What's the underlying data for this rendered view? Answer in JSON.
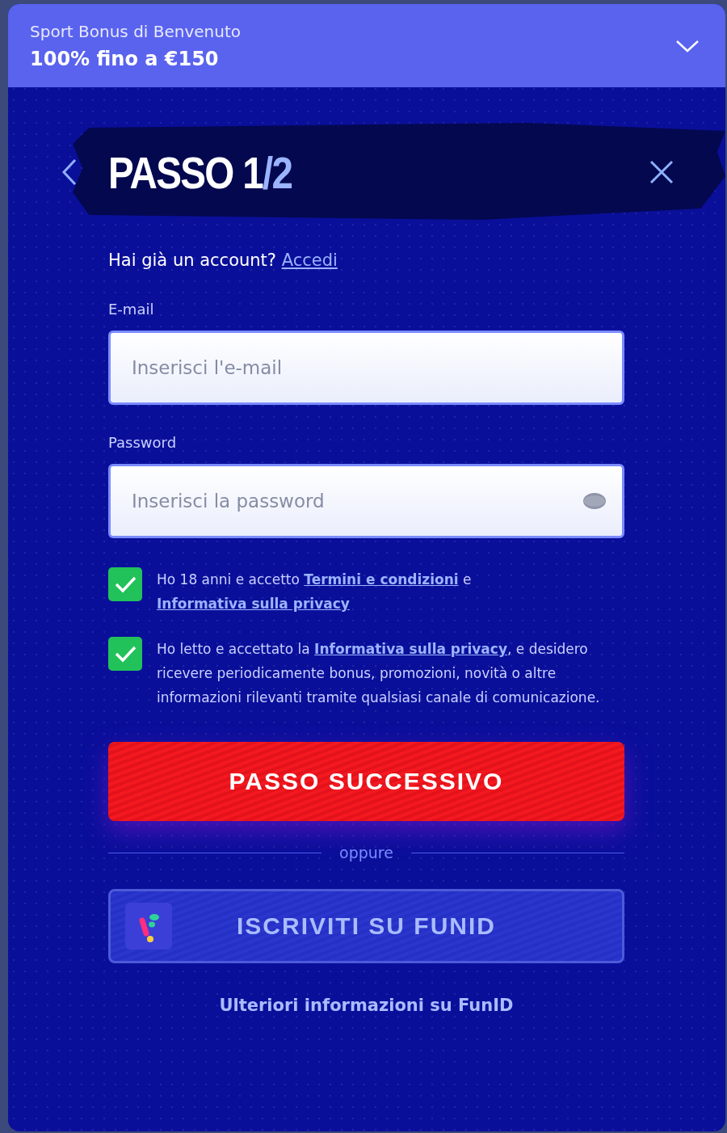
{
  "bonus_bar": {
    "subtitle": "Sport Bonus di Benvenuto",
    "headline": "100% fino a €150",
    "expanded": false
  },
  "step_title": {
    "main": "PASSO 1",
    "total": "/2"
  },
  "login_prompt": {
    "text": "Hai già un account?",
    "link": "Accedi"
  },
  "fields": [
    {
      "label": "E-mail",
      "placeholder": "Inserisci l'e-mail",
      "kind": "email"
    },
    {
      "label": "Password",
      "placeholder": "Inserisci la password",
      "kind": "password"
    }
  ],
  "consents": [
    {
      "checked": true,
      "parts": [
        {
          "text": "Ho 18 anni e accetto ",
          "link": false
        },
        {
          "text": "Termini e condizioni",
          "link": true
        },
        {
          "text": " e ",
          "link": false
        },
        {
          "text": "Informativa sulla privacy",
          "link": true
        }
      ]
    },
    {
      "checked": true,
      "parts": [
        {
          "text": "Ho letto e accettato la ",
          "link": false
        },
        {
          "text": "Informativa sulla privacy",
          "link": true
        },
        {
          "text": ", e desidero ricevere periodicamente bonus, promozioni, novità o altre informazioni rilevanti tramite qualsiasi canale di comunicazione.",
          "link": false
        }
      ]
    }
  ],
  "next_button": "PASSO SUCCESSIVO",
  "divider": "oppure",
  "funid_button": "ISCRIVITI SU FUNID",
  "funid_link": "Ulteriori informazioni su FunID"
}
